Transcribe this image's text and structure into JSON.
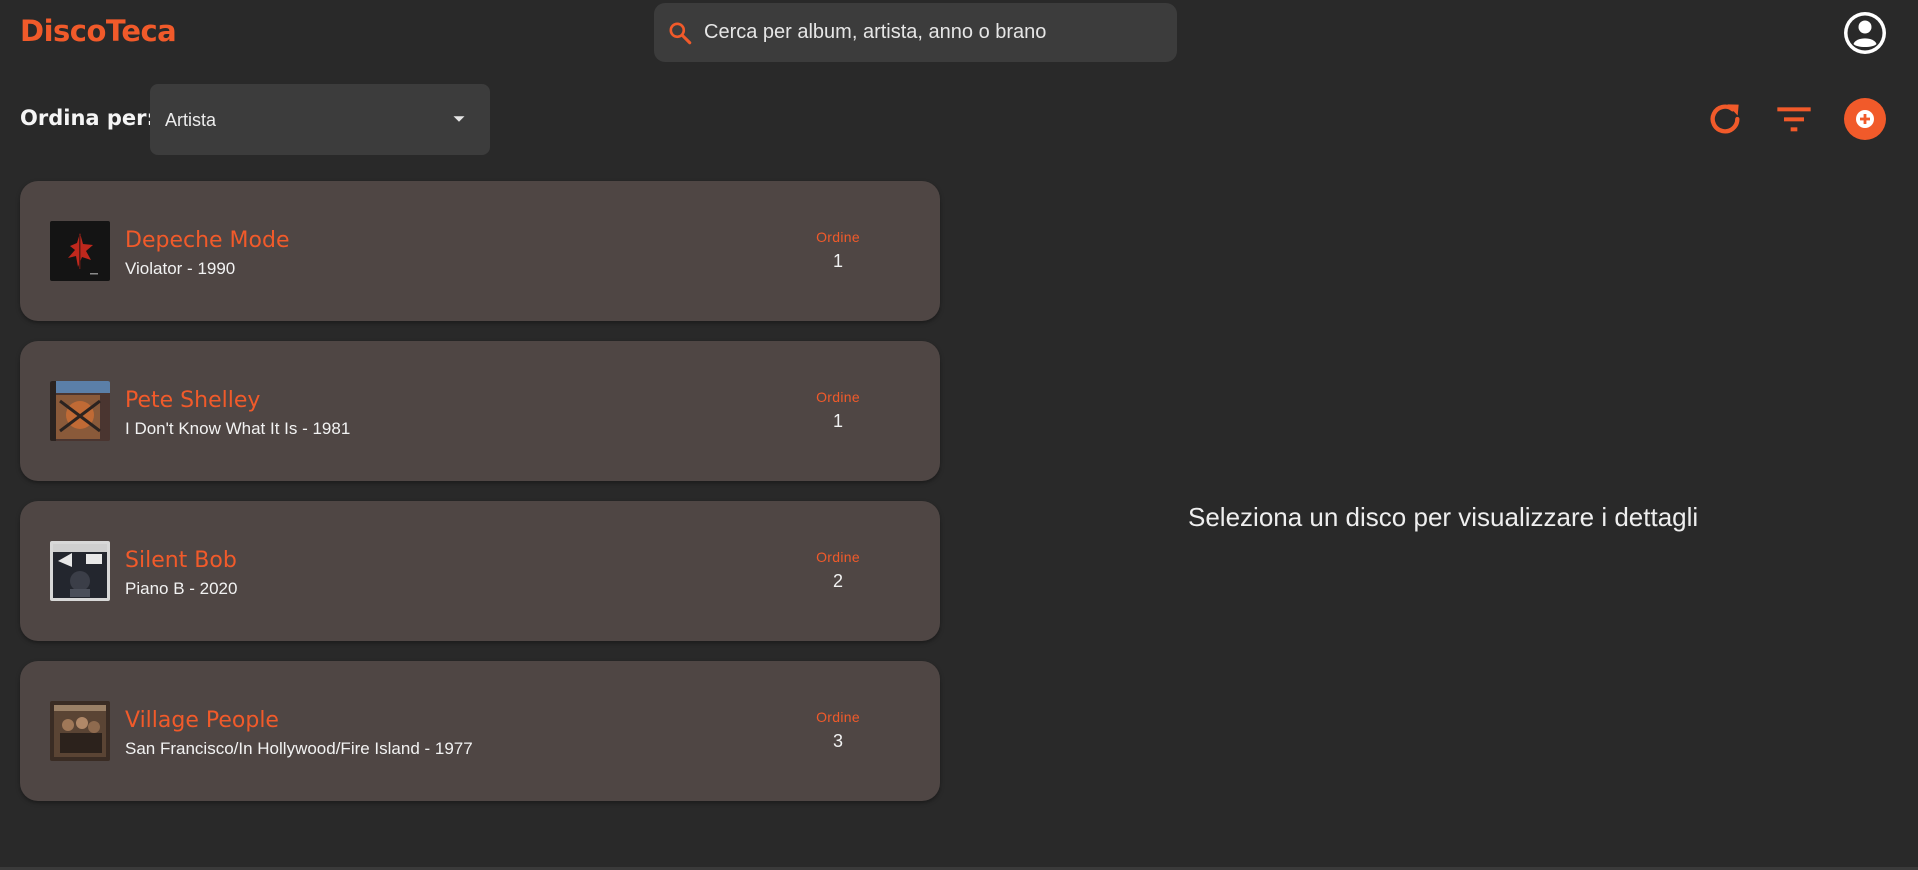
{
  "app": {
    "title": "DiscoTeca"
  },
  "search": {
    "placeholder": "Cerca per album, artista, anno o brano"
  },
  "toolbar": {
    "sort_label": "Ordina per:",
    "sort_value": "Artista"
  },
  "colors": {
    "accent": "#f15a2a",
    "background": "#292929",
    "card": "#4f4644",
    "field": "#3c3c3c"
  },
  "icons": [
    "search-icon",
    "account-circle-icon",
    "chevron-down-icon",
    "refresh-icon",
    "filter-icon",
    "add-circle-icon"
  ],
  "records": [
    {
      "artist": "Depeche Mode",
      "album": "Violator - 1990",
      "order_label": "Ordine",
      "order": "1"
    },
    {
      "artist": "Pete Shelley",
      "album": "I Don't Know What It Is - 1981",
      "order_label": "Ordine",
      "order": "1"
    },
    {
      "artist": "Silent Bob",
      "album": "Piano B - 2020",
      "order_label": "Ordine",
      "order": "2"
    },
    {
      "artist": "Village People",
      "album": "San Francisco/In Hollywood/Fire Island - 1977",
      "order_label": "Ordine",
      "order": "3"
    }
  ],
  "details": {
    "placeholder": "Seleziona un disco per visualizzare i dettagli"
  }
}
